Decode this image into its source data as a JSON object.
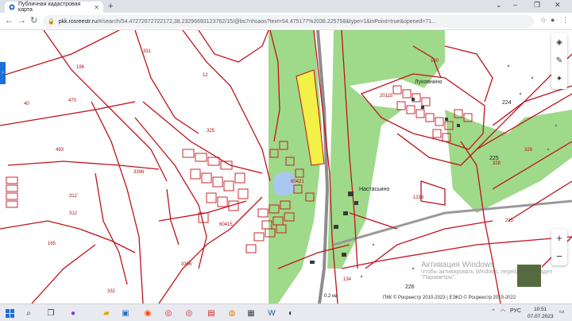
{
  "browser": {
    "tab_title": "Публичная кадастровая карта",
    "url_host": "pkk.rosreestr.ru",
    "url_path": "/#/search/54.47272672722172,38.23296693123762/15/@bs7nhsaos?text=54.475177%2038.225758&type=1&inPoint=true&opened=71..."
  },
  "map": {
    "labels": [
      "331",
      "196",
      "12",
      "40",
      "470",
      "493",
      "3396",
      "312",
      "312",
      "165",
      "332",
      "3396",
      "325",
      "60421",
      "134",
      "1316",
      "224",
      "225",
      "326",
      "328",
      "215",
      "226",
      "130",
      "20115",
      "60415"
    ],
    "places": {
      "nastasyino": "Настасьино",
      "lukovnino": "Луковнино"
    },
    "scale": "0.2 км",
    "copyright": "ПКК © Росреестр 2010-2023 | ЕЭКО © Росреестр 2019-2022",
    "activation_title": "Активация Windows",
    "activation_text": "Чтобы активировать Windows, перейдите в раздел \"Параметры\"."
  },
  "taskbar": {
    "lang": "РУС",
    "time": "10:51",
    "date": "07.07.2023"
  },
  "colors": {
    "parcel": "#c0121b",
    "forest": "#9fd98a",
    "highlight": "#f3f047",
    "water": "#a9c8ef",
    "accent": "#1e6fd9"
  }
}
